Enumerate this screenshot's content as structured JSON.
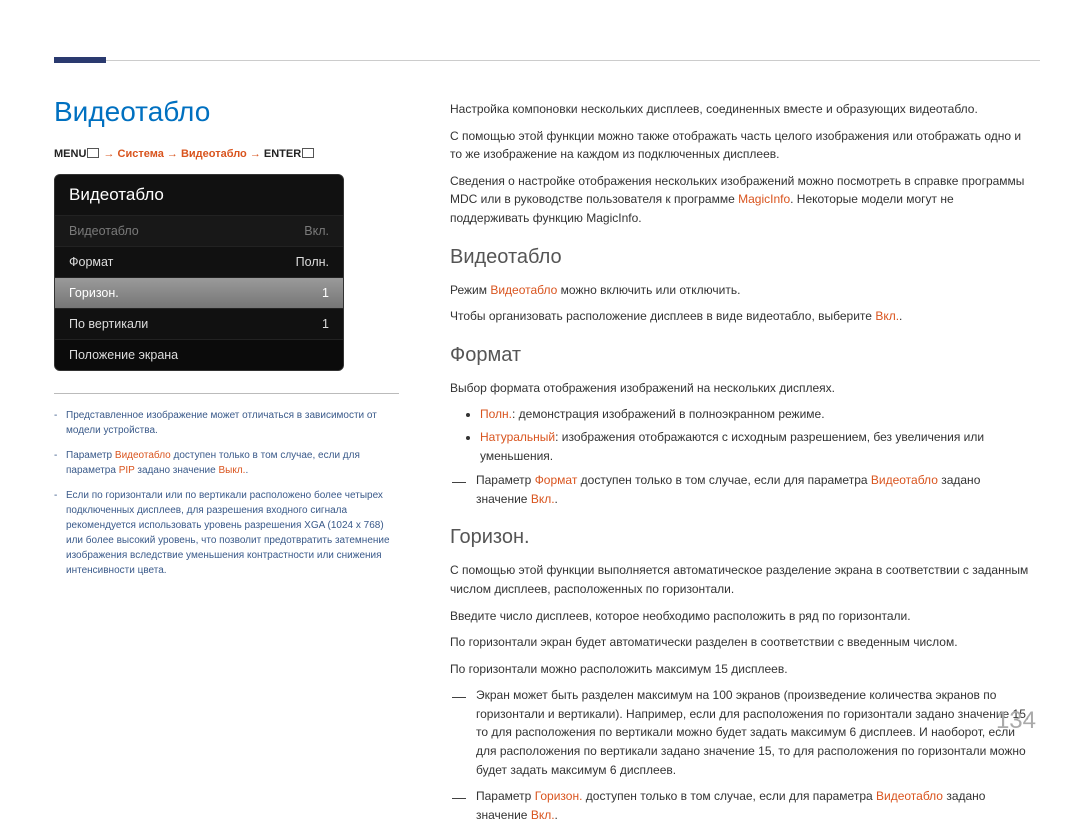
{
  "page_title": "Видеотабло",
  "breadcrumb": {
    "menu": "MENU",
    "arrow": " → ",
    "part1": "Система",
    "part2": "Видеотабло",
    "enter": "ENTER"
  },
  "menu_panel": {
    "header": "Видеотабло",
    "rows": [
      {
        "label": "Видеотабло",
        "value": "Вкл.",
        "style": "disabled"
      },
      {
        "label": "Формат",
        "value": "Полн.",
        "style": "dark"
      },
      {
        "label": "Горизон.",
        "value": "1",
        "style": "selected"
      },
      {
        "label": "По вертикали",
        "value": "1",
        "style": "dark"
      },
      {
        "label": "Положение экрана",
        "value": "",
        "style": "dark2"
      }
    ]
  },
  "small_notes": {
    "n1_a": "Представленное изображение может отличаться в зависимости от модели устройства.",
    "n2_a": "Параметр ",
    "n2_b": "Видеотабло",
    "n2_c": " доступен только в том случае, если для параметра ",
    "n2_d": "PIP",
    "n2_e": " задано значение ",
    "n2_f": "Выкл.",
    "n2_g": ".",
    "n3_a": "Если по горизонтали или по вертикали расположено более четырех подключенных дисплеев, для разрешения входного сигнала рекомендуется использовать уровень разрешения XGA (1024 x 768) или более высокий уровень, что позволит предотвратить затемнение изображения вследствие уменьшения контрастности или снижения интенсивности цвета."
  },
  "intro": {
    "p1": "Настройка компоновки нескольких дисплеев, соединенных вместе и образующих видеотабло.",
    "p2": "С помощью этой функции можно также отображать часть целого изображения или отображать одно и то же изображение на каждом из подключенных дисплеев.",
    "p3_a": "Сведения о настройке отображения нескольких изображений можно посмотреть в справке программы MDC или в руководстве пользователя к программе ",
    "p3_b": "MagicInfo",
    "p3_c": ". Некоторые модели могут не поддерживать функцию MagicInfo."
  },
  "section_video": {
    "title": "Видеотабло",
    "p1_a": "Режим ",
    "p1_b": "Видеотабло",
    "p1_c": " можно включить или отключить.",
    "p2_a": "Чтобы организовать расположение дисплеев в виде видеотабло, выберите ",
    "p2_b": "Вкл.",
    "p2_c": "."
  },
  "section_format": {
    "title": "Формат",
    "p1": "Выбор формата отображения изображений на нескольких дисплеях.",
    "b1_a": "Полн.",
    "b1_b": ": демонстрация изображений в полноэкранном режиме.",
    "b2_a": "Натуральный",
    "b2_b": ": изображения отображаются с исходным разрешением, без увеличения или уменьшения.",
    "note_a": "Параметр ",
    "note_b": "Формат",
    "note_c": " доступен только в том случае, если для параметра ",
    "note_d": "Видеотабло",
    "note_e": " задано значение ",
    "note_f": "Вкл.",
    "note_g": "."
  },
  "section_horiz": {
    "title": "Горизон.",
    "p1": "С помощью этой функции выполняется автоматическое разделение экрана в соответствии с заданным числом дисплеев, расположенных по горизонтали.",
    "p2": "Введите число дисплеев, которое необходимо расположить в ряд по горизонтали.",
    "p3": "По горизонтали экран будет автоматически разделен в соответствии с введенным числом.",
    "p4": "По горизонтали можно расположить максимум 15 дисплеев.",
    "note1": "Экран может быть разделен максимум на 100 экранов (произведение количества экранов по горизонтали и вертикали). Например, если для расположения по горизонтали задано значение 15, то для расположения по вертикали можно будет задать максимум 6 дисплеев. И наоборот, если для расположения по вертикали задано значение 15, то для расположения по горизонтали можно будет задать максимум 6 дисплеев.",
    "note2_a": "Параметр ",
    "note2_b": "Горизон.",
    "note2_c": " доступен только в том случае, если для параметра ",
    "note2_d": "Видеотабло",
    "note2_e": " задано значение ",
    "note2_f": "Вкл.",
    "note2_g": "."
  },
  "page_number": "134"
}
